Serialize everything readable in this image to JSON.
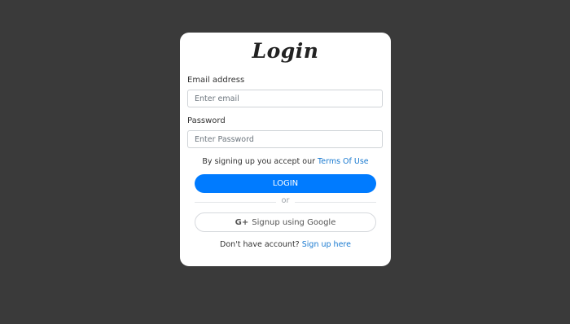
{
  "login": {
    "title": "Login",
    "email_label": "Email address",
    "email_placeholder": "Enter email",
    "email_value": "",
    "password_label": "Password",
    "password_placeholder": "Enter Password",
    "password_value": "",
    "terms_prefix": "By signing up you accept our ",
    "terms_link": "Terms Of Use",
    "login_button": "LOGIN",
    "divider_text": "or",
    "google_icon": "G+",
    "google_icon_name": "google-plus-icon",
    "google_button": "Signup using Google",
    "signup_prefix": "Don't have account? ",
    "signup_link": "Sign up here"
  },
  "colors": {
    "background": "#3a3a3a",
    "card": "#ffffff",
    "primary_button": "#007bff",
    "link": "#1a7ad0"
  }
}
